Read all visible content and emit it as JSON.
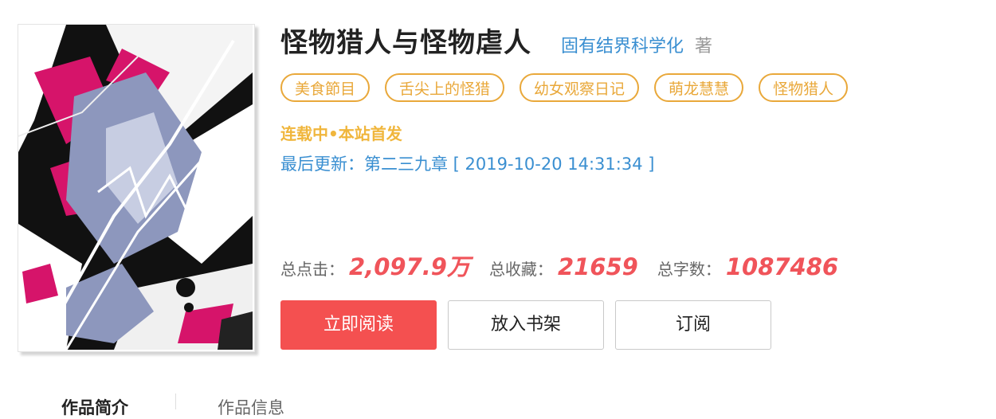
{
  "book": {
    "title": "怪物猎人与怪物虐人",
    "author": "固有结界科学化",
    "author_suffix": "著",
    "cover_alt": "book-cover-art"
  },
  "tags": [
    "美食節目",
    "舌尖上的怪猎",
    "幼女观察日记",
    "萌龙慧慧",
    "怪物猎人"
  ],
  "status": "连载中•本站首发",
  "last_update": "最后更新：第二三九章 [ 2019-10-20 14:31:34 ]",
  "stats": {
    "clicks_label": "总点击：",
    "clicks_value": "2,097.9万",
    "favorites_label": "总收藏：",
    "favorites_value": "21659",
    "words_label": "总字数：",
    "words_value": "1087486"
  },
  "buttons": {
    "read": "立即阅读",
    "shelf": "放入书架",
    "subscribe": "订阅"
  },
  "tabs": {
    "intro": "作品简介",
    "info": "作品信息"
  },
  "colors": {
    "title": "#222222",
    "link": "#3a8fd1",
    "tag": "#e9a83a",
    "status": "#f0b63c",
    "stat_value": "#f0545a",
    "primary_button": "#f45050"
  }
}
